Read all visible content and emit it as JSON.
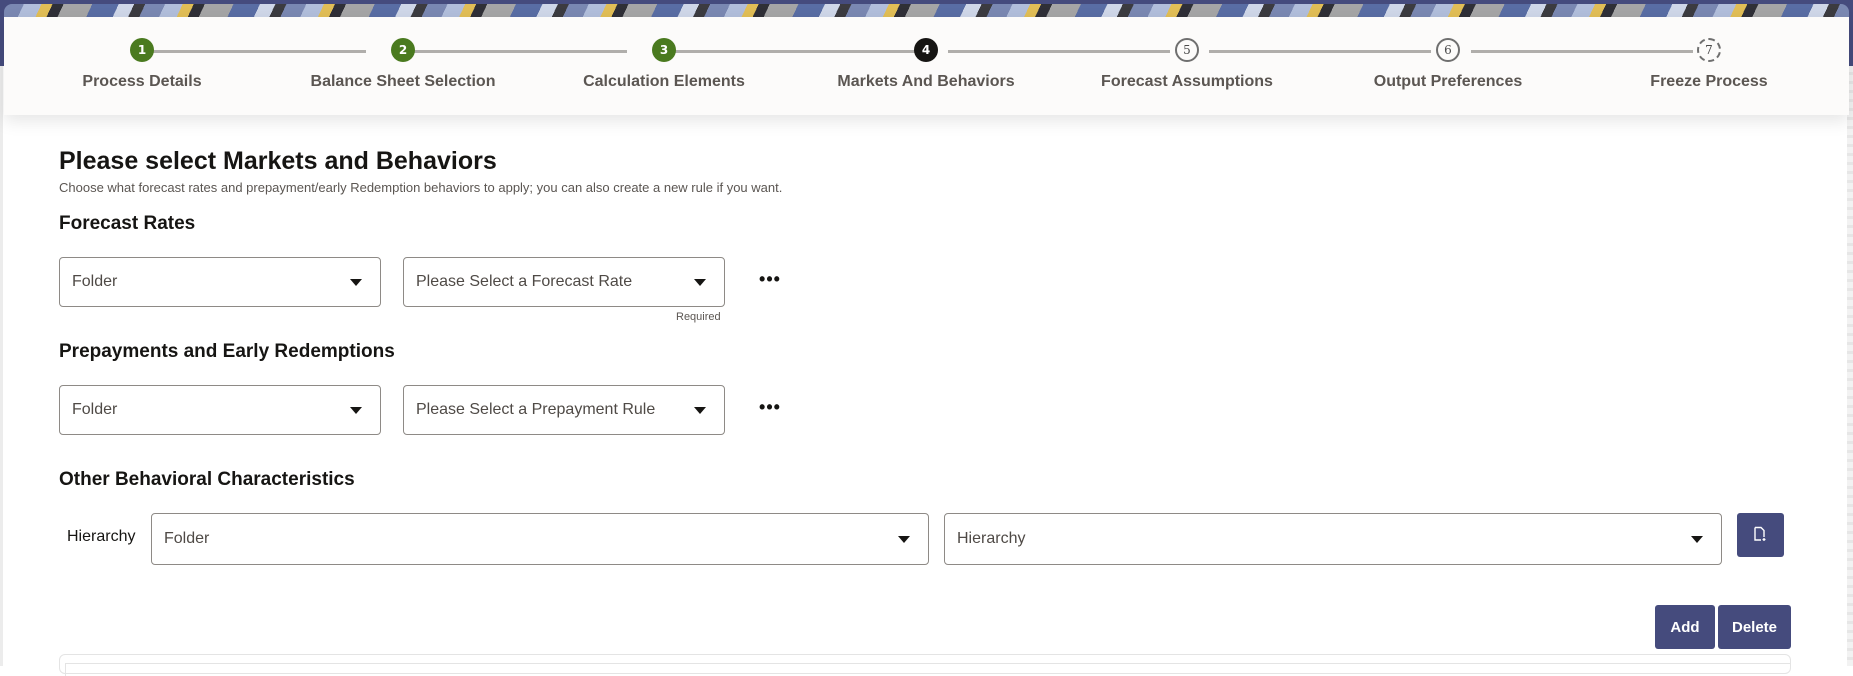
{
  "train": {
    "steps": [
      {
        "number": "1",
        "label": "Process Details",
        "state": "completed"
      },
      {
        "number": "2",
        "label": "Balance Sheet Selection",
        "state": "completed"
      },
      {
        "number": "3",
        "label": "Calculation Elements",
        "state": "completed"
      },
      {
        "number": "4",
        "label": "Markets And Behaviors",
        "state": "current"
      },
      {
        "number": "5",
        "label": "Forecast Assumptions",
        "state": "not-visited"
      },
      {
        "number": "6",
        "label": "Output Preferences",
        "state": "not-visited"
      },
      {
        "number": "7",
        "label": "Freeze Process",
        "state": "disabled"
      }
    ]
  },
  "page": {
    "title": "Please select Markets and Behaviors",
    "subtitle": "Choose what forecast rates and prepayment/early Redemption behaviors to apply; you can also create a new rule if you want."
  },
  "forecast_rates": {
    "title": "Forecast Rates",
    "folder_select": "Folder",
    "rule_select": "Please Select a Forecast Rate",
    "required_text": "Required",
    "more_label": "•••"
  },
  "prepayments": {
    "title": "Prepayments and Early Redemptions",
    "folder_select": "Folder",
    "rule_select": "Please Select a Prepayment Rule",
    "more_label": "•••"
  },
  "other_behavioral": {
    "title": "Other Behavioral Characteristics",
    "hierarchy_label": "Hierarchy",
    "folder_select": "Folder",
    "hierarchy_select": "Hierarchy",
    "new_button_icon": "new-document-icon"
  },
  "actions": {
    "add_label": "Add",
    "delete_label": "Delete"
  },
  "colors": {
    "brand": "#454b7d",
    "completed_step": "#4a7a1f",
    "current_step": "#161513"
  }
}
